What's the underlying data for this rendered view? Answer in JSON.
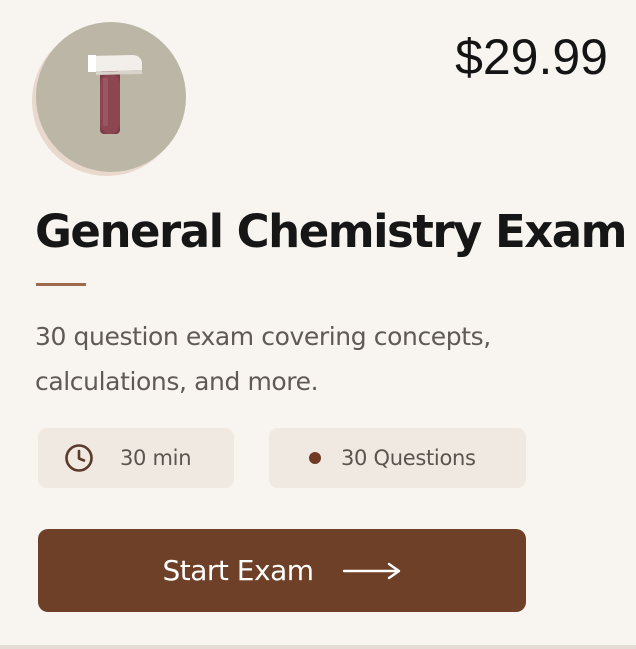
{
  "price": "$29.99",
  "exam": {
    "icon": "hammer-test-tube-icon",
    "title": "General Chemistry Exam",
    "description": "30 question exam covering concepts, calculations, and more."
  },
  "meta": {
    "duration": "30 min",
    "duration_icon": "clock-icon",
    "questions": "30 Questions",
    "questions_icon": "dot-icon"
  },
  "cta": {
    "label": "Start Exam",
    "icon": "arrow-right-icon"
  },
  "colors": {
    "background": "#f8f4f0",
    "accent": "#6f4028",
    "rule": "#9e6a4c",
    "pill": "#f0e9e2",
    "avatar": "#bcb6a7"
  }
}
